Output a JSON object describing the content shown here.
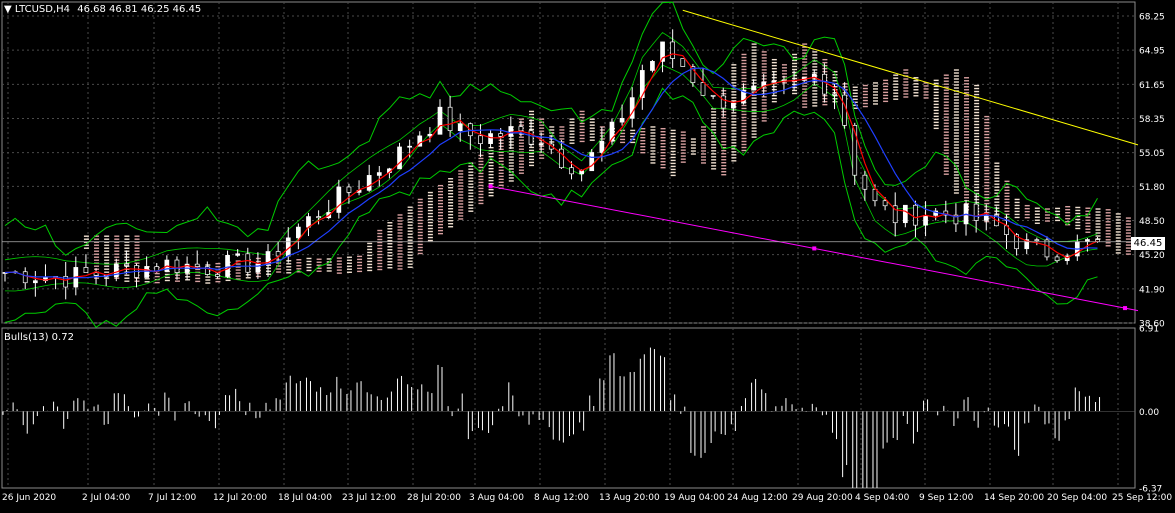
{
  "header": {
    "symbol": "LTCUSD,H4",
    "ohlc": "46.68 46.81 46.25 46.45",
    "indicator": "Bulls(13) 0.72"
  },
  "last_price_label": "46.45",
  "colors": {
    "background": "#000000",
    "grid": "#4a4a4a",
    "axis_text": "#ffffff",
    "bull_candle": "#ffffff",
    "envelope": "#00cc00",
    "ma_red": "#ff0000",
    "ma_blue": "#1f3fff",
    "cloud_a": "#d8a0a0",
    "cloud_b": "#f0e0d0",
    "trend_upper": "#ffff00",
    "trend_lower": "#ff00ff",
    "bulls_bar": "#ffffff"
  },
  "chart_data": [
    {
      "type": "candlestick",
      "title": "LTCUSD,H4",
      "y_ticks": [
        "68.25",
        "64.95",
        "61.65",
        "58.35",
        "55.05",
        "51.80",
        "48.50",
        "45.20",
        "41.90",
        "38.60"
      ],
      "ylim": [
        38.6,
        69.6
      ],
      "x_ticks": [
        "26 Jun 2020",
        "2 Jul 04:00",
        "7 Jul 12:00",
        "12 Jul 20:00",
        "18 Jul 04:00",
        "23 Jul 12:00",
        "28 Jul 20:00",
        "3 Aug 04:00",
        "8 Aug 12:00",
        "13 Aug 20:00",
        "19 Aug 04:00",
        "24 Aug 12:00",
        "29 Aug 20:00",
        "4 Sep 04:00",
        "9 Sep 12:00",
        "14 Sep 20:00",
        "20 Sep 04:00",
        "25 Sep 12:00"
      ],
      "price_profile": [
        [
          0,
          43.5
        ],
        [
          6,
          43.0
        ],
        [
          12,
          43.8
        ],
        [
          16,
          44.3
        ],
        [
          20,
          44.0
        ],
        [
          26,
          44.5
        ],
        [
          28,
          47.0
        ],
        [
          32,
          50.0
        ],
        [
          35,
          52.0
        ],
        [
          37,
          53.5
        ],
        [
          39,
          55.0
        ],
        [
          41,
          57.0
        ],
        [
          43,
          58.5
        ],
        [
          45,
          57.0
        ],
        [
          47,
          56.5
        ],
        [
          50,
          57.0
        ],
        [
          53,
          56.5
        ],
        [
          55,
          54.5
        ],
        [
          57,
          53.5
        ],
        [
          60,
          57.0
        ],
        [
          62,
          60.5
        ],
        [
          63,
          63.0
        ],
        [
          65,
          65.0
        ],
        [
          67,
          63.5
        ],
        [
          70,
          60.0
        ],
        [
          73,
          60.5
        ],
        [
          76,
          61.0
        ],
        [
          78,
          61.5
        ],
        [
          80,
          62.5
        ],
        [
          82,
          61.0
        ],
        [
          83,
          58.0
        ],
        [
          84,
          53.5
        ],
        [
          86,
          50.0
        ],
        [
          88,
          48.8
        ],
        [
          91,
          49.3
        ],
        [
          95,
          49.0
        ],
        [
          98,
          47.8
        ],
        [
          101,
          46.0
        ],
        [
          103,
          45.5
        ],
        [
          106,
          46.0
        ],
        [
          108,
          46.45
        ]
      ],
      "last_price": 46.45,
      "series": [
        {
          "name": "upper trendline",
          "points": [
            [
              67,
              68.8
            ],
            [
              112,
              55.8
            ]
          ]
        },
        {
          "name": "lower trendline",
          "points": [
            [
              48,
              51.8
            ],
            [
              112,
              39.8
            ]
          ]
        }
      ]
    },
    {
      "type": "bar",
      "title": "Bulls(13) 0.72",
      "y_ticks": [
        "6.91",
        "0.00",
        "-6.37"
      ],
      "ylim": [
        -6.37,
        6.91
      ],
      "current_value": 0.72
    }
  ]
}
